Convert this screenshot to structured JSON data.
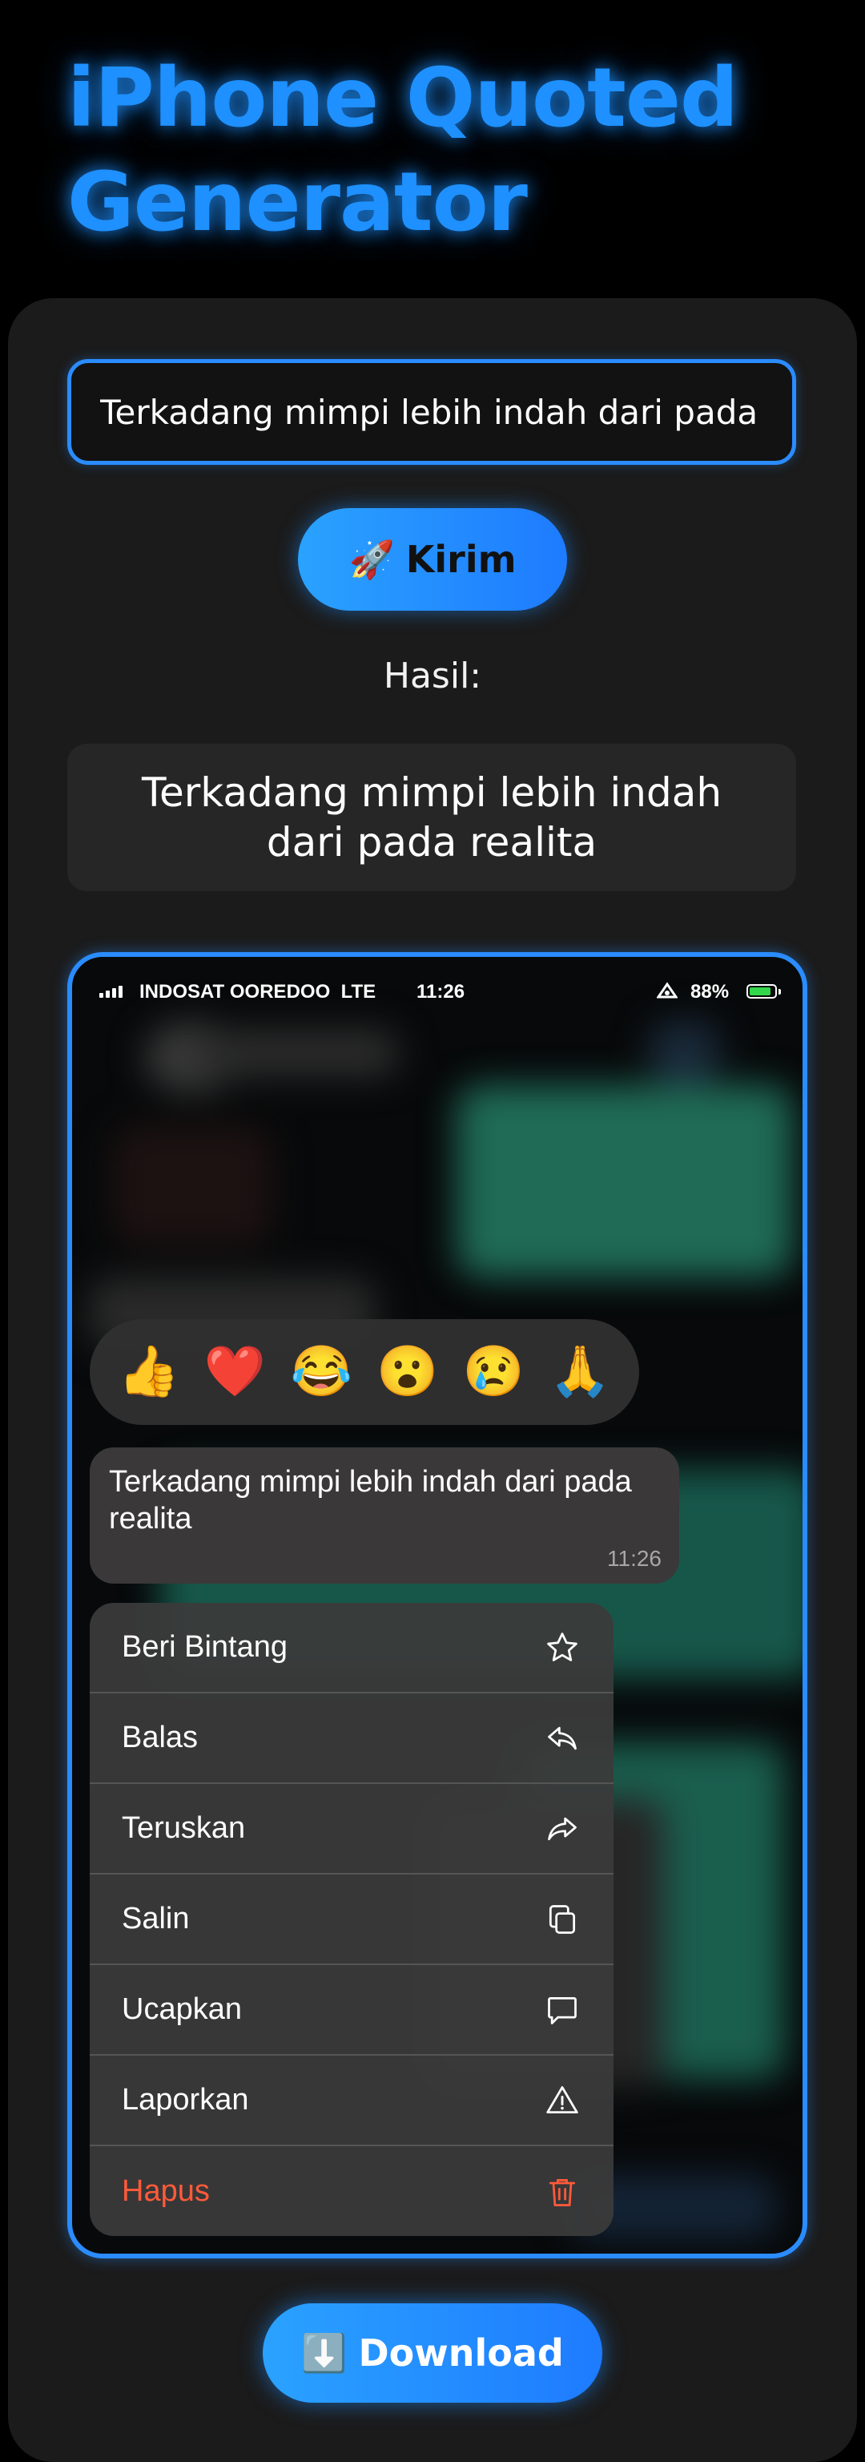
{
  "page": {
    "title": "iPhone Quoted Generator"
  },
  "form": {
    "input_value": "Terkadang mimpi lebih indah dari pada",
    "send_icon": "🚀",
    "send_label": "Kirim",
    "result_label": "Hasil:",
    "result_text": "Terkadang mimpi lebih indah dari pada realita"
  },
  "phone": {
    "status": {
      "carrier": "INDOSAT OOREDOO",
      "network": "LTE",
      "time": "11:26",
      "battery_percent": "88%",
      "battery_level": 0.88,
      "battery_color": "#33d64a"
    },
    "reactions": [
      "👍",
      "❤️",
      "😂",
      "😮",
      "😢",
      "🙏"
    ],
    "message": {
      "text": "Terkadang mimpi lebih indah dari pada realita",
      "time": "11:26"
    },
    "menu": [
      {
        "label": "Beri Bintang",
        "icon": "star-icon"
      },
      {
        "label": "Balas",
        "icon": "reply-icon"
      },
      {
        "label": "Teruskan",
        "icon": "forward-icon"
      },
      {
        "label": "Salin",
        "icon": "copy-icon"
      },
      {
        "label": "Ucapkan",
        "icon": "speech-bubble-icon"
      },
      {
        "label": "Laporkan",
        "icon": "warning-icon"
      },
      {
        "label": "Hapus",
        "icon": "trash-icon",
        "color": "#ff5a3a"
      }
    ]
  },
  "download": {
    "icon": "⬇️",
    "label": "Download"
  },
  "colors": {
    "accent": "#1e90ff",
    "danger": "#ff5a3a"
  }
}
